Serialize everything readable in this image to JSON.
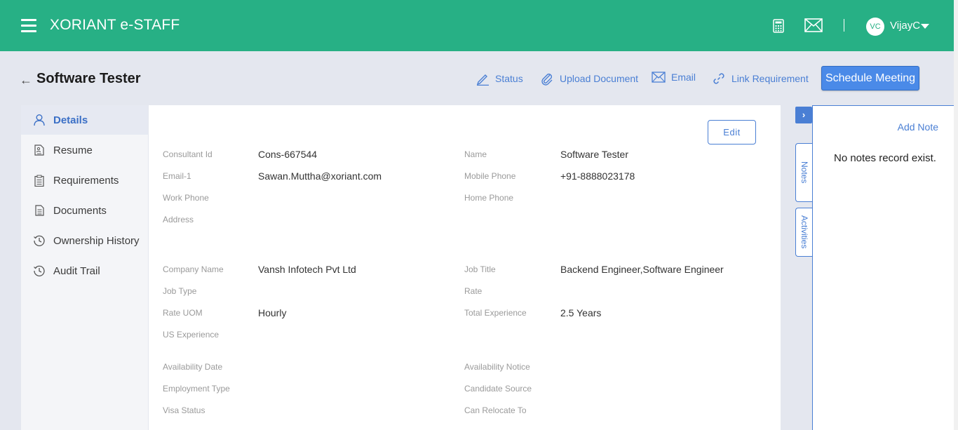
{
  "app": {
    "title": "XORIANT e-STAFF"
  },
  "user": {
    "initials": "VC",
    "name": "VijayC"
  },
  "page": {
    "title": "Software Tester"
  },
  "actions": {
    "status": "Status",
    "upload": "Upload Document",
    "email": "Email",
    "link": "Link Requirement",
    "schedule": "Schedule Meeting"
  },
  "sidebar": {
    "items": [
      {
        "label": "Details",
        "icon": "person-icon",
        "active": true
      },
      {
        "label": "Resume",
        "icon": "resume-icon"
      },
      {
        "label": "Requirements",
        "icon": "clipboard-icon"
      },
      {
        "label": "Documents",
        "icon": "document-icon"
      },
      {
        "label": "Ownership History",
        "icon": "history-icon"
      },
      {
        "label": "Audit Trail",
        "icon": "history-icon"
      }
    ]
  },
  "details": {
    "edit_label": "Edit",
    "fields": {
      "consultant_id": {
        "label": "Consultant Id",
        "value": "Cons-667544"
      },
      "name": {
        "label": "Name",
        "value": "Software Tester"
      },
      "email1": {
        "label": "Email-1",
        "value": "Sawan.Muttha@xoriant.com"
      },
      "mobile_phone": {
        "label": "Mobile Phone",
        "value": "+91-8888023178"
      },
      "work_phone": {
        "label": "Work Phone",
        "value": ""
      },
      "home_phone": {
        "label": "Home Phone",
        "value": ""
      },
      "address": {
        "label": "Address",
        "value": ""
      },
      "company_name": {
        "label": "Company Name",
        "value": "Vansh Infotech Pvt Ltd"
      },
      "job_title": {
        "label": "Job Title",
        "value": "Backend Engineer,Software Engineer"
      },
      "job_type": {
        "label": "Job Type",
        "value": ""
      },
      "rate": {
        "label": "Rate",
        "value": ""
      },
      "rate_uom": {
        "label": "Rate UOM",
        "value": "Hourly"
      },
      "total_experience": {
        "label": "Total Experience",
        "value": "2.5 Years"
      },
      "us_experience": {
        "label": "US Experience",
        "value": ""
      },
      "availability_date": {
        "label": "Availability Date",
        "value": ""
      },
      "availability_notice": {
        "label": "Availability Notice",
        "value": ""
      },
      "employment_type": {
        "label": "Employment Type",
        "value": ""
      },
      "candidate_source": {
        "label": "Candidate Source",
        "value": ""
      },
      "visa_status": {
        "label": "Visa Status",
        "value": ""
      },
      "can_relocate_to": {
        "label": "Can Relocate To",
        "value": ""
      }
    }
  },
  "side_panel": {
    "toggle": "›",
    "tabs": [
      "Notes",
      "Activities"
    ],
    "add_note": "Add Note",
    "empty_message": "No notes record exist."
  },
  "colors": {
    "header": "#27b085",
    "accent": "#4a7fd4",
    "button": "#4a8ae8"
  }
}
